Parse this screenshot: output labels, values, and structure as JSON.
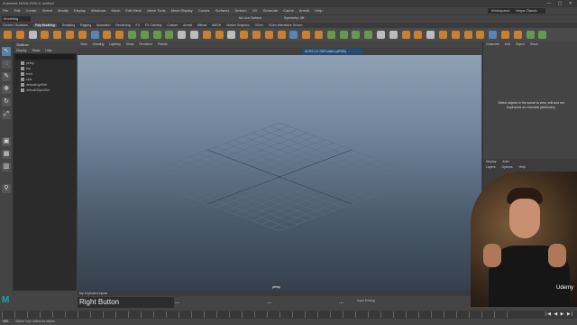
{
  "titlebar": {
    "title": "Autodesk MAYA 2020.3: untitled"
  },
  "menubar": {
    "items": [
      "File",
      "Edit",
      "Create",
      "Select",
      "Modify",
      "Display",
      "Windows",
      "Mesh",
      "Edit Mesh",
      "Mesh Tools",
      "Mesh Display",
      "Curves",
      "Surfaces",
      "Deform",
      "UV",
      "Generate",
      "Cache",
      "Arnold",
      "Help"
    ],
    "workspace_label": "Workspace:",
    "workspace_value": "Maya Classic"
  },
  "statusline": {
    "mode": "Modeling",
    "symmetry": "Symmetry: Off",
    "no_live": "No Live Surface"
  },
  "shelf_tabs": [
    "Curves / Surfaces",
    "Poly Modeling",
    "Sculpting",
    "Rigging",
    "Animation",
    "Rendering",
    "FX",
    "FX Caching",
    "Custom",
    "Arnold",
    "Bifrost",
    "MASH",
    "Motion Graphics",
    "XGen",
    "XGen Interactive Groom"
  ],
  "shelf_active": "Poly Modeling",
  "outliner": {
    "title": "Outliner",
    "menu": [
      "Display",
      "Show",
      "Help"
    ],
    "items": [
      "persp",
      "top",
      "front",
      "side",
      "defaultLightSet",
      "defaultObjectSet"
    ]
  },
  "viewport": {
    "menu": [
      "View",
      "Shading",
      "Lighting",
      "Show",
      "Renderer",
      "Panels"
    ],
    "colorspace": "ACES 1.0 SDR-video (sRGB)",
    "camera_label": "persp"
  },
  "channelbox": {
    "menu": [
      "Channels",
      "Edit",
      "Object",
      "Show"
    ],
    "message": "Select objects in the scene to view, edit and set keyframes on channels (attributes)"
  },
  "layers": {
    "tabs": [
      "Display",
      "Anim"
    ],
    "menu": [
      "Layers",
      "Options",
      "Help"
    ]
  },
  "cmdline": {
    "header": "My Keyboard Inputs",
    "big_text": "Right Button",
    "dots": [
      "...",
      "...",
      "..."
    ],
    "no_label": "Input Ending"
  },
  "timeline": {
    "start": "1",
    "end": "120",
    "playback": "|◀ ◀ ▶ ▶|"
  },
  "helpline": {
    "mel": "MEL",
    "text": "Select Tool: select an object"
  },
  "brand": {
    "maya": "M",
    "udemy": "Udemy"
  },
  "colors": {
    "accent": "#13a7b6",
    "shelf_orange": "#e08a2c",
    "shelf_green": "#6aa84f",
    "viewport_top": "#8fa0b4",
    "viewport_bottom": "#34404c"
  }
}
